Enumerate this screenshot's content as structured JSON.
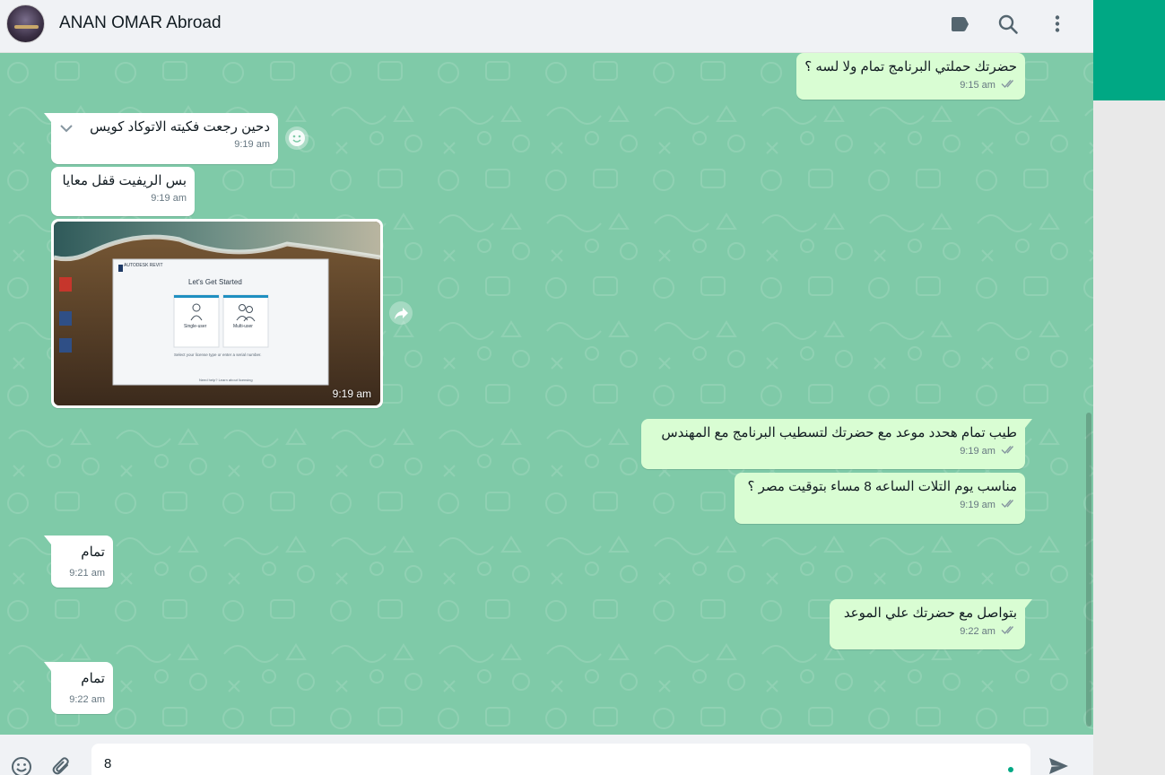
{
  "header": {
    "contact_name": "ANAN OMAR Abroad",
    "icons": [
      "label-icon",
      "search-icon",
      "menu-icon"
    ]
  },
  "messages": [
    {
      "dir": "out",
      "text": "حضرتك حملتي البرنامج تمام ولا لسه ؟",
      "time": "9:15 am"
    },
    {
      "dir": "in",
      "text": "دحين رجعت فكيته الاتوكاد كويس",
      "time": "9:19 am"
    },
    {
      "dir": "in",
      "text": "بس الريفيت قفل معايا",
      "time": "9:19 am"
    },
    {
      "dir": "in",
      "type": "image",
      "time": "9:19 am",
      "image_text": {
        "brand": "AUTODESK REVIT",
        "title": "Let's Get Started",
        "option1": "Single-user",
        "option2": "Multi-user",
        "footer": "Select your license type or enter a serial number.",
        "link": "Need help? Learn about licensing"
      }
    },
    {
      "dir": "out",
      "text": "طيب تمام هحدد موعد مع حضرتك لتسطيب البرنامج مع المهندس",
      "time": "9:19 am"
    },
    {
      "dir": "out",
      "text": "مناسب يوم التلات الساعه 8 مساء بتوقيت مصر ؟",
      "time": "9:19 am"
    },
    {
      "dir": "in",
      "text": "تمام",
      "time": "9:21 am"
    },
    {
      "dir": "out",
      "text": "بتواصل مع حضرتك علي الموعد",
      "time": "9:22 am"
    },
    {
      "dir": "in",
      "text": "تمام",
      "time": "9:22 am"
    }
  ],
  "composer": {
    "value": "8"
  },
  "colors": {
    "chat_bg": "#7fcaa8",
    "outgoing_bubble": "#d9fdd3",
    "incoming_bubble": "#ffffff",
    "accent": "#00a884",
    "header_bg": "#f0f2f5"
  }
}
